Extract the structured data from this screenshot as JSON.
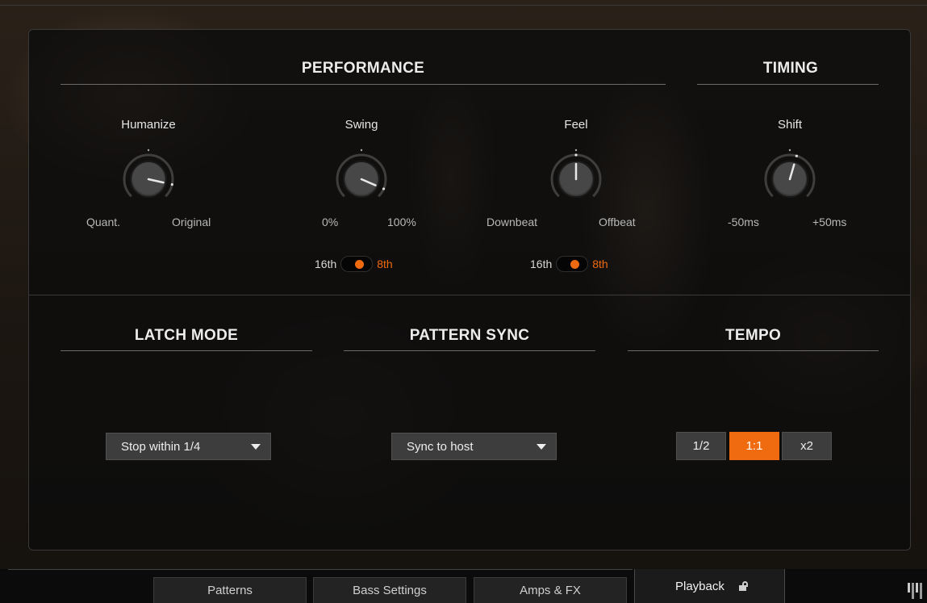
{
  "performance": {
    "title": "PERFORMANCE",
    "knobs": [
      {
        "label": "Humanize",
        "min_label": "Quant.",
        "max_label": "Original",
        "value": 0.88
      },
      {
        "label": "Swing",
        "min_label": "0%",
        "max_label": "100%",
        "value": 0.92
      },
      {
        "label": "Feel",
        "min_label": "Downbeat",
        "max_label": "Offbeat",
        "value": 0.5
      }
    ],
    "swing_toggle": {
      "off_label": "16th",
      "on_label": "8th",
      "state": "8th"
    },
    "feel_toggle": {
      "off_label": "16th",
      "on_label": "8th",
      "state": "8th"
    }
  },
  "timing": {
    "title": "TIMING",
    "knob": {
      "label": "Shift",
      "min_label": "-50ms",
      "max_label": "+50ms",
      "value": 0.56
    }
  },
  "latch_mode": {
    "title": "LATCH MODE",
    "value": "Stop within 1/4"
  },
  "pattern_sync": {
    "title": "PATTERN SYNC",
    "value": "Sync to host"
  },
  "tempo": {
    "title": "TEMPO",
    "options": [
      "1/2",
      "1:1",
      "x2"
    ],
    "selected": "1:1"
  },
  "tabs": [
    {
      "label": "Patterns"
    },
    {
      "label": "Bass Settings"
    },
    {
      "label": "Amps & FX"
    },
    {
      "label": "Playback"
    }
  ],
  "colors": {
    "accent": "#f06a10",
    "panel": "#0c0c0c",
    "button": "#3d3d3d"
  },
  "icons": {
    "lock": "lock-open-icon",
    "keyboard": "piano-keys-icon"
  }
}
